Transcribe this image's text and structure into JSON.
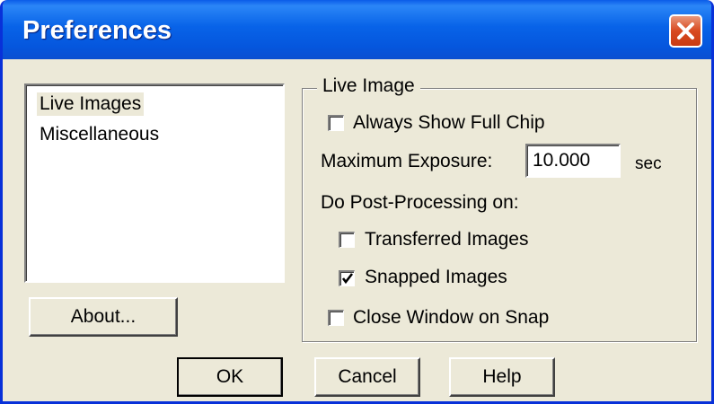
{
  "window": {
    "title": "Preferences"
  },
  "list": {
    "items": [
      {
        "label": "Live Images",
        "selected": true
      },
      {
        "label": "Miscellaneous",
        "selected": false
      }
    ]
  },
  "buttons": {
    "about": "About...",
    "ok": "OK",
    "cancel": "Cancel",
    "help": "Help"
  },
  "live_image": {
    "group_title": "Live Image",
    "always_show_full_chip": {
      "label": "Always Show Full Chip",
      "checked": false
    },
    "max_exposure": {
      "label": "Maximum Exposure:",
      "value": "10.000",
      "unit": "sec"
    },
    "post_processing_label": "Do Post-Processing on:",
    "transferred_images": {
      "label": "Transferred Images",
      "checked": false
    },
    "snapped_images": {
      "label": "Snapped Images",
      "checked": true
    },
    "close_window_on_snap": {
      "label": "Close Window on Snap",
      "checked": false
    }
  },
  "colors": {
    "titlebar": "#0863e8",
    "close_button": "#d8491f",
    "dialog_background": "#ece9d8"
  },
  "icons": {
    "close": "close-icon",
    "check": "checkmark-icon"
  }
}
